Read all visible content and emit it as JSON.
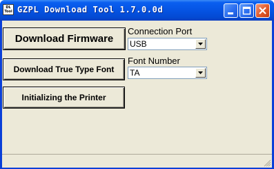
{
  "window": {
    "title": "GZPL Download Tool 1.7.0.0d",
    "icon_text_line1": "DL",
    "icon_text_line2": "Tool"
  },
  "titlebar_buttons": {
    "minimize": "minimize-icon",
    "maximize": "maximize-icon",
    "close": "close-icon"
  },
  "buttons": {
    "download_firmware": "Download Firmware",
    "download_font": "Download True Type Font",
    "initialize_printer": "Initializing the Printer"
  },
  "connection_port": {
    "label": "Connection Port",
    "value": "USB"
  },
  "font_number": {
    "label": "Font  Number",
    "value": "TA"
  },
  "colors": {
    "titlebar": "#0554e3",
    "client_background": "#ece9d8",
    "close_button": "#e05a2a"
  }
}
